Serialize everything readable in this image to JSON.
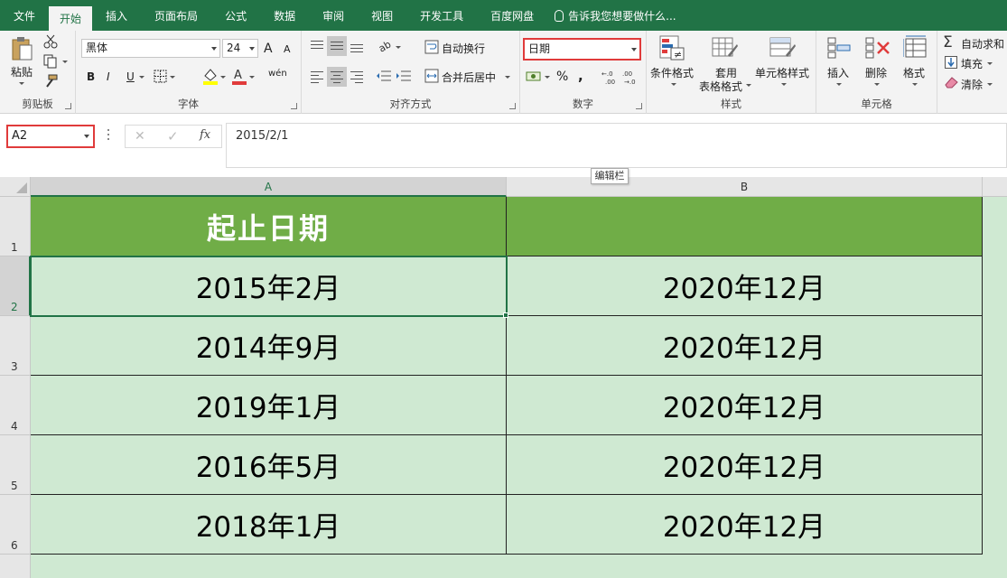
{
  "tabs": [
    {
      "label": "文件",
      "active": false
    },
    {
      "label": "开始",
      "active": true
    },
    {
      "label": "插入",
      "active": false
    },
    {
      "label": "页面布局",
      "active": false
    },
    {
      "label": "公式",
      "active": false
    },
    {
      "label": "数据",
      "active": false
    },
    {
      "label": "审阅",
      "active": false
    },
    {
      "label": "视图",
      "active": false
    },
    {
      "label": "开发工具",
      "active": false
    },
    {
      "label": "百度网盘",
      "active": false
    }
  ],
  "tell_me": "告诉我您想要做什么...",
  "ribbon": {
    "clipboard": {
      "label": "剪贴板",
      "paste": "粘贴"
    },
    "font": {
      "label": "字体",
      "font_name": "黑体",
      "font_size": "24",
      "bold": "B",
      "italic": "I",
      "underline": "U",
      "grow": "A",
      "shrink": "A",
      "phonetic": "wén"
    },
    "alignment": {
      "label": "对齐方式",
      "wrap": "自动换行",
      "merge": "合并后居中"
    },
    "number": {
      "label": "数字",
      "format": "日期",
      "percent": "%",
      "comma": ","
    },
    "styles": {
      "label": "样式",
      "conditional": "条件格式",
      "table_format_1": "套用",
      "table_format_2": "表格格式",
      "cell_styles": "单元格样式"
    },
    "cells": {
      "label": "单元格",
      "insert": "插入",
      "delete": "删除",
      "format": "格式"
    },
    "editing": {
      "autosum": "自动求和",
      "fill": "填充",
      "clear": "清除"
    }
  },
  "formula_bar": {
    "name_box": "A2",
    "formula": "2015/2/1",
    "fx": "fx",
    "tooltip": "编辑栏"
  },
  "grid": {
    "columns": [
      "A",
      "B"
    ],
    "rows": [
      "1",
      "2",
      "3",
      "4",
      "5",
      "6"
    ],
    "header_cell": "起止日期",
    "data": [
      [
        "2015年2月",
        "2020年12月"
      ],
      [
        "2014年9月",
        "2020年12月"
      ],
      [
        "2019年1月",
        "2020年12月"
      ],
      [
        "2016年5月",
        "2020年12月"
      ],
      [
        "2018年1月",
        "2020年12月"
      ]
    ]
  },
  "colors": {
    "accent": "#217346",
    "header_fill": "#70ad47",
    "data_fill": "#cfe9d2",
    "highlight": "#e03b3b"
  }
}
